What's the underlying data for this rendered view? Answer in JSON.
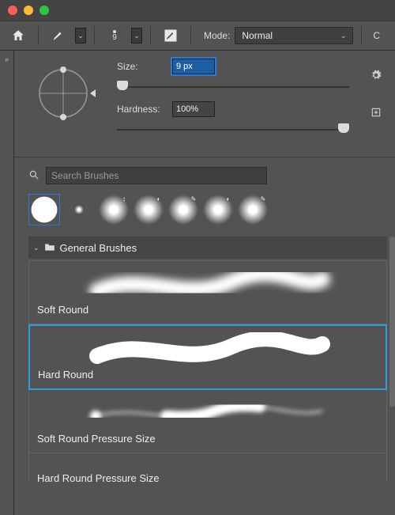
{
  "window": {
    "traffic_colors": [
      "#ff5f57",
      "#febc2e",
      "#28c840"
    ]
  },
  "toolbar": {
    "brush_size_indicator": "9",
    "mode_label": "Mode:",
    "mode_value": "Normal",
    "right_letter": "C"
  },
  "brush_settings": {
    "size_label": "Size:",
    "size_value": "9 px",
    "hardness_label": "Hardness:",
    "hardness_value": "100%"
  },
  "search": {
    "placeholder": "Search Brushes",
    "value": ""
  },
  "folder": {
    "name": "General Brushes"
  },
  "brushes": [
    {
      "name": "Soft Round",
      "selected": false
    },
    {
      "name": "Hard Round",
      "selected": true
    },
    {
      "name": "Soft Round Pressure Size",
      "selected": false
    },
    {
      "name": "Hard Round Pressure Size",
      "selected": false
    }
  ],
  "left_strip_expand": "»"
}
